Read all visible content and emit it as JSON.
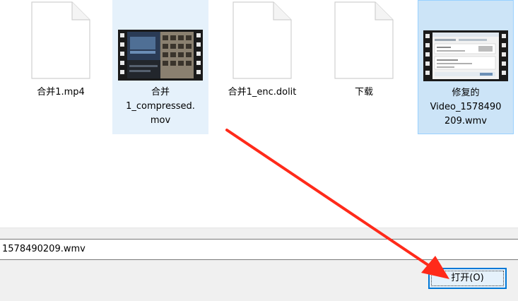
{
  "files": [
    {
      "name": "合并1.mp4",
      "type": "generic-file-icon",
      "selected": false
    },
    {
      "name": "合并\n1_compressed.\nmov",
      "type": "video-thumbnail",
      "selected": true
    },
    {
      "name": "合并1_enc.dolit",
      "type": "generic-file-icon",
      "selected": false
    },
    {
      "name": "下载",
      "type": "generic-file-icon",
      "selected": false
    },
    {
      "name": "修复的\nVideo_1578490\n209.wmv",
      "type": "video-thumbnail",
      "selected": true
    }
  ],
  "filename_field": {
    "value": "1578490209.wmv"
  },
  "open_button": {
    "label": "打开(O)"
  },
  "annotation": {
    "color": "#ff2a1a"
  }
}
